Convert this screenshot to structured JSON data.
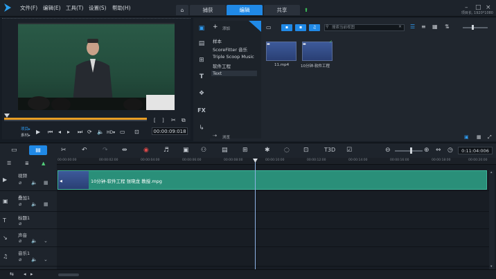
{
  "menu": [
    "文件(F)",
    "编辑(E)",
    "工具(T)",
    "设置(S)",
    "帮助(H)"
  ],
  "tabs": {
    "home_icon": "home-icon",
    "capture": "捕获",
    "edit": "编辑",
    "share": "共享"
  },
  "window": {
    "resolution": "项目长, 1920*1080",
    "upload_icon": "upload-icon"
  },
  "preview": {
    "project_label": "项目▸",
    "clip_label": "素材▸",
    "timecode": "00:00:09:018"
  },
  "library": {
    "add_label": "添加",
    "folders": [
      "样本",
      "ScoreFitter 音乐",
      "Triple Scoop Music",
      "软件工程",
      "Text"
    ],
    "selected_folder": "Text",
    "browse_label": "浏览",
    "search_placeholder": "搜索当前视图",
    "items": [
      {
        "label": "11.mp4"
      },
      {
        "label": "10分钟-软件工程"
      }
    ]
  },
  "timeline": {
    "timecode": "0:11:04:006",
    "ticks": [
      "00:00:00:00",
      "00:00:02:00",
      "00:00:04:00",
      "00:00:06:00",
      "00:00:08:00",
      "00:00:10:00",
      "00:00:12:00",
      "00:00:14:00",
      "00:00:16:00",
      "00:00:18:00",
      "00:00:20:00"
    ],
    "tracks": [
      {
        "name": "视频"
      },
      {
        "name": "叠加1"
      },
      {
        "name": "标题1"
      },
      {
        "name": "声音"
      },
      {
        "name": "音乐1"
      }
    ],
    "clip_title": "10分钟-软件工程 张晓龙 教授.mpg"
  },
  "colors": {
    "accent": "#2089e6",
    "clip": "#2a8f79",
    "scrub": "#e89d24"
  }
}
